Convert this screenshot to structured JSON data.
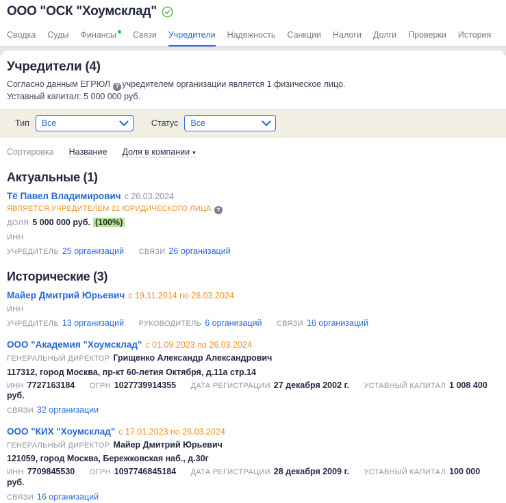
{
  "icons": {
    "help": "?",
    "sort_desc": "▾"
  },
  "colors": {
    "accent_blue": "#2467d6",
    "accent_orange": "#ee8f1f",
    "verified_green": "#57b847",
    "badge_dot_green": "#1ec83c",
    "share_highlight": "#b7e49a",
    "filter_bg": "#f1efe3"
  },
  "header": {
    "title": "ООО \"ОСК \"Хоумсклад\""
  },
  "tabs": [
    {
      "label": "Сводка"
    },
    {
      "label": "Суды"
    },
    {
      "label": "Финансы"
    },
    {
      "label": "Связи"
    },
    {
      "label": "Учредители",
      "active": true
    },
    {
      "label": "Надежность"
    },
    {
      "label": "Санкции"
    },
    {
      "label": "Налоги"
    },
    {
      "label": "Долги"
    },
    {
      "label": "Проверки"
    },
    {
      "label": "История"
    }
  ],
  "founders": {
    "heading": "Учредители (4)",
    "egrul_prefix": "Согласно данным ЕГРЮЛ",
    "egrul_suffix": "учредителем организации является 1 физическое лицо.",
    "capital_line": "Уставный капитал: 5 000 000 руб.",
    "filters": {
      "type_label": "Тип",
      "type_value": "Все",
      "status_label": "Статус",
      "status_value": "Все"
    },
    "sorting": {
      "label": "Сортировка",
      "by_name": "Название",
      "by_share": "Доля в компании"
    }
  },
  "actual": {
    "heading": "Актуальные (1)",
    "person": {
      "name": "Тё Павел Владимирович",
      "period": "с 26.03.2024",
      "notice": "ЯВЛЯЕТСЯ УЧРЕДИТЕЛЕМ 21 ЮРИДИЧЕСКОГО ЛИЦА",
      "share_label": "ДОЛЯ",
      "share_value": "5 000 000 руб.",
      "share_percent": "(100%)",
      "inn_label": "ИНН",
      "founder_label": "УЧРЕДИТЕЛЬ",
      "founder_count": "25 организаций",
      "links_label": "СВЯЗИ",
      "links_count": "26 организаций"
    }
  },
  "historical": {
    "heading": "Исторические (3)",
    "person": {
      "name": "Майер Дмитрий Юрьевич",
      "period": "с 19.11.2014 по 26.03.2024",
      "inn_label": "ИНН",
      "founder_label": "УЧРЕДИТЕЛЬ",
      "founder_count": "13 организаций",
      "head_label": "РУКОВОДИТЕЛЬ",
      "head_count": "6 организаций",
      "links_label": "СВЯЗИ",
      "links_count": "16 организаций"
    },
    "companies": [
      {
        "name": "ООО \"Академия \"Хоумсклад\"",
        "period": "с 01.09.2023 по 26.03.2024",
        "director_label": "ГЕНЕРАЛЬНЫЙ ДИРЕКТОР",
        "director": "Грищенко Александр Александрович",
        "address": "117312, город Москва, пр-кт 60-летия Октября, д.11а стр.14",
        "inn_label": "ИНН",
        "inn": "7727163184",
        "ogrn_label": "ОГРН",
        "ogrn": "1027739914355",
        "reg_label": "ДАТА РЕГИСТРАЦИИ",
        "reg_date": "27 декабря 2002 г.",
        "capital_label": "УСТАВНЫЙ КАПИТАЛ",
        "capital": "1 008 400 руб.",
        "links_label": "СВЯЗИ",
        "links_count": "32 организации"
      },
      {
        "name": "ООО \"КИХ \"Хоумсклад\"",
        "period": "с 17.01.2023 по 26.03.2024",
        "director_label": "ГЕНЕРАЛЬНЫЙ ДИРЕКТОР",
        "director": "Майер Дмитрий Юрьевич",
        "address": "121059, город Москва, Бережковская наб., д.30г",
        "inn_label": "ИНН",
        "inn": "7709845530",
        "ogrn_label": "ОГРН",
        "ogrn": "1097746845184",
        "reg_label": "ДАТА РЕГИСТРАЦИИ",
        "reg_date": "28 декабря 2009 г.",
        "capital_label": "УСТАВНЫЙ КАПИТАЛ",
        "capital": "100 000 руб.",
        "links_label": "СВЯЗИ",
        "links_count": "16 организаций"
      }
    ]
  }
}
